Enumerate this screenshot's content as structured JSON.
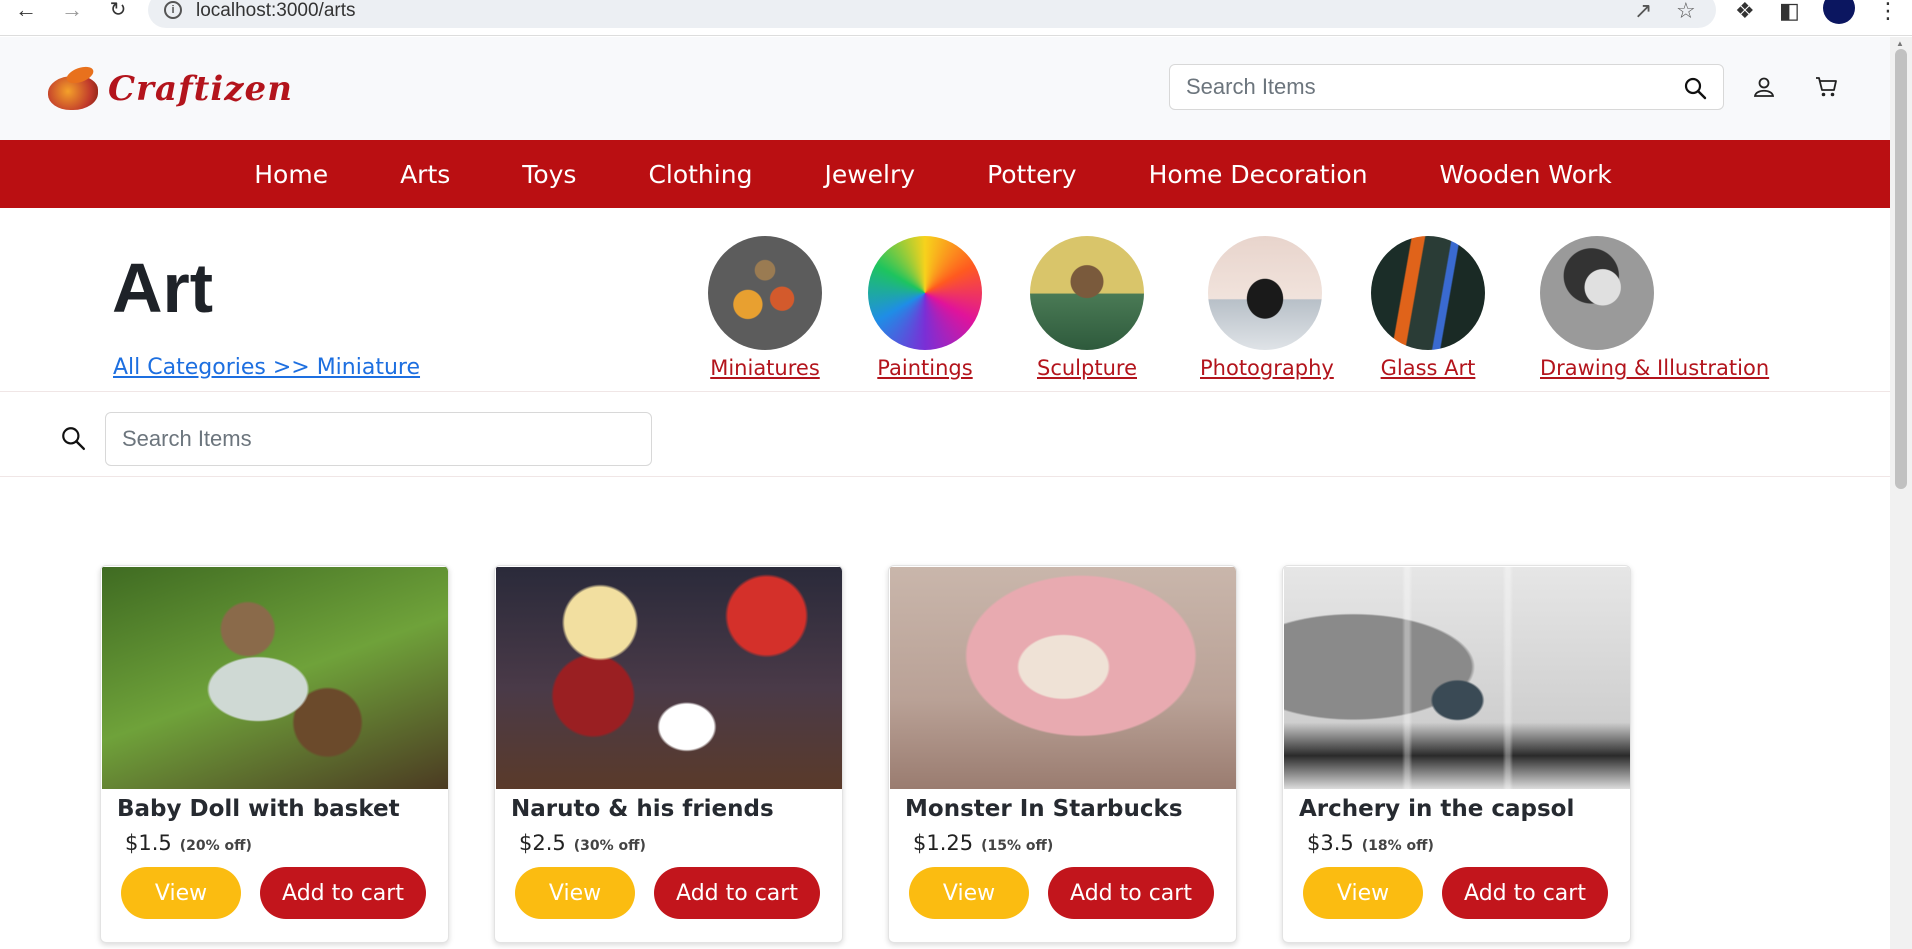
{
  "browser": {
    "url": "localhost:3000/arts"
  },
  "header": {
    "brand": "Craftizen",
    "search_placeholder": "Search Items"
  },
  "nav": {
    "items": [
      "Home",
      "Arts",
      "Toys",
      "Clothing",
      "Jewelry",
      "Pottery",
      "Home Decoration",
      "Wooden Work"
    ]
  },
  "hero": {
    "title": "Art",
    "breadcrumb": "All Categories  >> Miniature",
    "subcategories": [
      {
        "label": "Miniatures"
      },
      {
        "label": "Paintings"
      },
      {
        "label": "Sculpture"
      },
      {
        "label": "Photography"
      },
      {
        "label": "Glass Art"
      },
      {
        "label": "Drawing & Illustration"
      }
    ]
  },
  "filter": {
    "search_placeholder": "Search Items"
  },
  "products": [
    {
      "title": "Baby Doll with basket",
      "price": "$1.5",
      "discount": "(20% off)",
      "view_label": "View",
      "cart_label": "Add to cart"
    },
    {
      "title": "Naruto & his friends",
      "price": "$2.5",
      "discount": "(30% off)",
      "view_label": "View",
      "cart_label": "Add to cart"
    },
    {
      "title": "Monster In Starbucks",
      "price": "$1.25",
      "discount": "(15% off)",
      "view_label": "View",
      "cart_label": "Add to cart"
    },
    {
      "title": "Archery in the capsol",
      "price": "$3.5",
      "discount": "(18% off)",
      "view_label": "View",
      "cart_label": "Add to cart"
    }
  ],
  "colors": {
    "brand_red": "#ba0f12",
    "view_yellow": "#fbbc11",
    "cart_red": "#c2151c",
    "link_blue": "#1d6fe0"
  }
}
